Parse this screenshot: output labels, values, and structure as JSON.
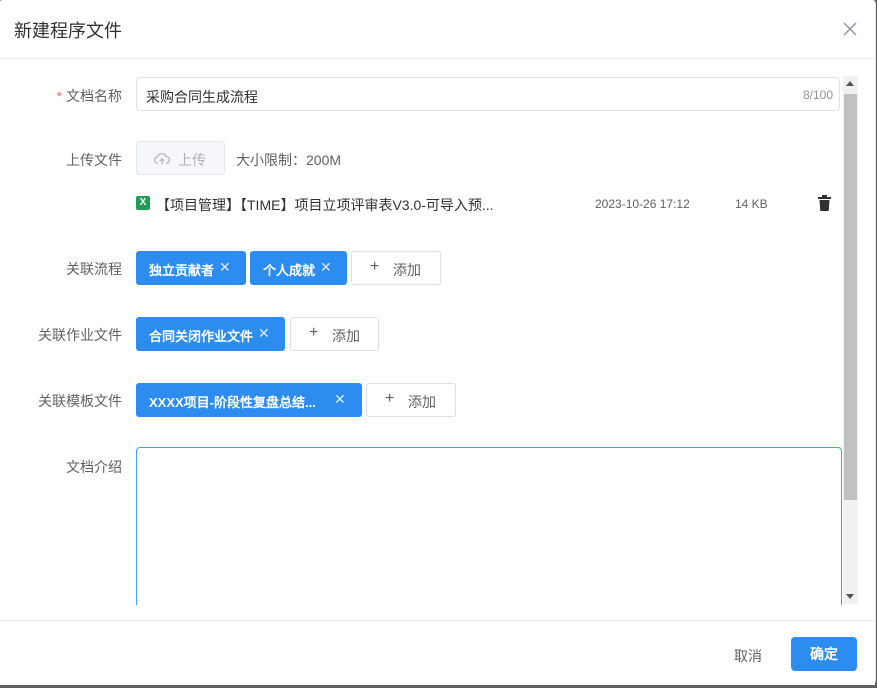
{
  "dialog": {
    "title": "新建程序文件"
  },
  "form": {
    "doc_name": {
      "label": "文档名称",
      "required_mark": "*",
      "value": "采购合同生成流程",
      "counter": "8/100"
    },
    "upload": {
      "label": "上传文件",
      "button_label": "上传",
      "size_hint": "大小限制：200M",
      "file": {
        "icon_letter": "X",
        "name": "【项目管理】【TIME】项目立项评审表V3.0-可导入预...",
        "date": "2023-10-26 17:12",
        "size": "14 KB"
      }
    },
    "related_process": {
      "label": "关联流程",
      "tags": [
        "独立贡献者",
        "个人成就"
      ],
      "add_label": "添加"
    },
    "related_work_files": {
      "label": "关联作业文件",
      "tags": [
        "合同关闭作业文件"
      ],
      "add_label": "添加"
    },
    "related_template_files": {
      "label": "关联模板文件",
      "tags": [
        "XXXX项目-阶段性复盘总结..."
      ],
      "add_label": "添加"
    },
    "doc_intro": {
      "label": "文档介绍",
      "value": ""
    }
  },
  "footer": {
    "cancel_label": "取消",
    "confirm_label": "确定"
  },
  "colors": {
    "primary": "#2d8cf0",
    "required": "#f56c6c",
    "focus_border": "#409eff"
  }
}
